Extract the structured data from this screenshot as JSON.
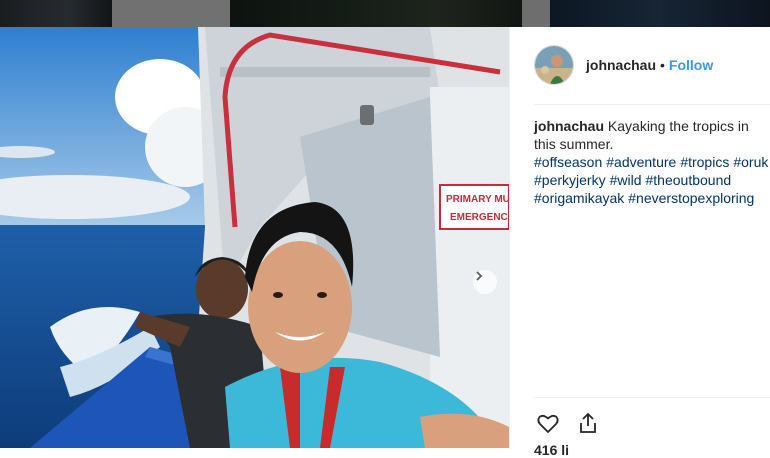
{
  "post": {
    "username": "johnachau",
    "separator": "•",
    "follow_label": "Follow",
    "caption_text": "Kayaking the tropics in this summer.",
    "hashtags_lines": [
      [
        "#offseason",
        "#adventure",
        "#tropics",
        "#oruk"
      ],
      [
        "#perkyjerky",
        "#wild",
        "#theoutbound"
      ],
      [
        "#origamikayak",
        "#neverstopexploring"
      ]
    ],
    "likes_partial": "416 li"
  },
  "photo_text": {
    "sign_line1": "PRIMARY MU",
    "sign_line2": "EMERGENCY"
  },
  "icons": [
    "heart-icon",
    "share-icon",
    "chevron-right-icon"
  ],
  "colors": {
    "link": "#3897f0",
    "hashtag": "#003569",
    "text": "#262626"
  }
}
